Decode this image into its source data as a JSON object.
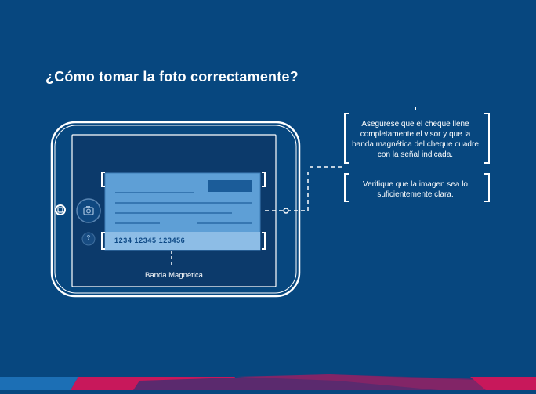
{
  "title": "¿Cómo tomar la foto correctamente?",
  "tips": [
    "Asegúrese que el cheque llene completamente el visor y que la banda magnética del cheque cuadre con la señal indicada.",
    "Verifique que la imagen sea lo suficientemente clara."
  ],
  "check": {
    "number_line": "1234 12345 123456",
    "band_label": "Banda Magnética"
  },
  "controls": {
    "help_glyph": "?",
    "camera_icon": "camera-icon",
    "home_icon": "home-button-icon"
  },
  "colors": {
    "background": "#07477f",
    "screen": "#0c3a6b",
    "check_fill": "#5e9fd6",
    "check_stripe": "#8dbde6",
    "accent_pink": "#c8185b",
    "accent_blue": "#1c6fb5",
    "accent_purple": "#5b2a6e"
  }
}
